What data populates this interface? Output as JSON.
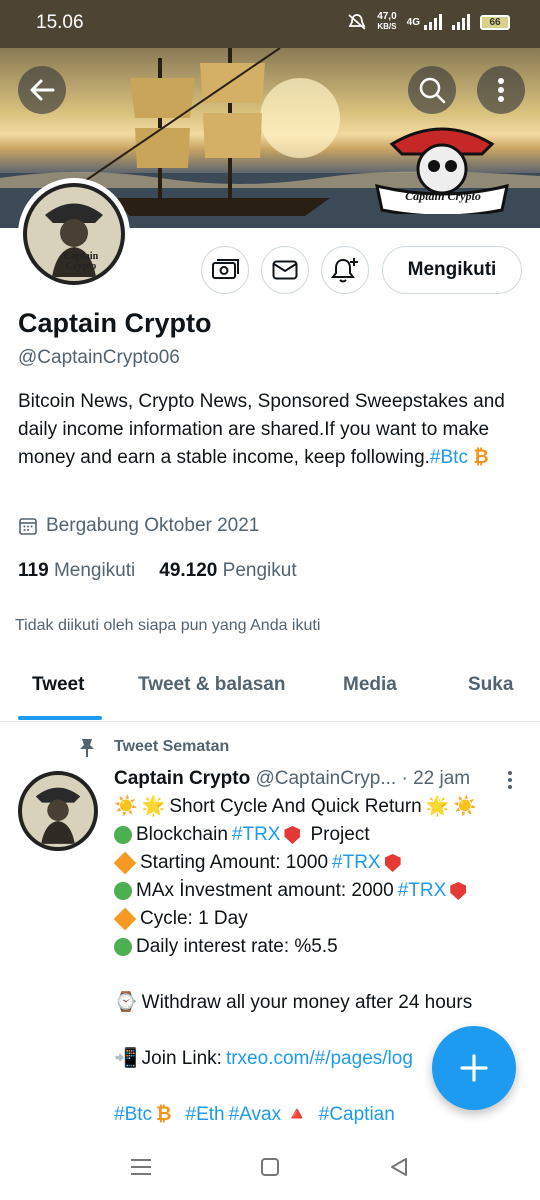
{
  "status_bar": {
    "time": "15.06",
    "net_speed_value": "47,0",
    "net_speed_unit": "KB/S",
    "network": "4G",
    "battery": "66"
  },
  "header": {
    "banner_logo_text": "Captain Crypto"
  },
  "profile": {
    "avatar_text": "Captain Crypto",
    "follow_button_label": "Mengikuti",
    "name": "Captain Crypto",
    "handle": "@CaptainCrypto06",
    "bio_text": "Bitcoin News, Crypto News, Sponsored Sweepstakes and daily income information are shared.If you want to make money and earn a stable income, keep following.",
    "bio_hashtag": "#Btc",
    "bio_emoji": "₿",
    "joined": "Bergabung Oktober 2021",
    "following_count": "119",
    "following_label": "Mengikuti",
    "followers_count": "49.120",
    "followers_label": "Pengikut",
    "not_followed_note": "Tidak diikuti oleh siapa pun yang Anda ikuti"
  },
  "tabs": [
    {
      "label": "Tweet",
      "active": true
    },
    {
      "label": "Tweet & balasan",
      "active": false
    },
    {
      "label": "Media",
      "active": false
    },
    {
      "label": "Suka",
      "active": false
    }
  ],
  "pinned_tweet": {
    "pinned_label": "Tweet Sematan",
    "author_name": "Captain Crypto",
    "author_handle": "@CaptainCryp...",
    "separator": "·",
    "time": "22 jam",
    "line1": "Short Cycle And Quick Return",
    "line2_text": "Blockchain",
    "line2_tag": "#TRX",
    "line2_end": "Project",
    "line3_text": "Starting Amount: 1000",
    "line3_tag": "#TRX",
    "line4_text": "MAx İnvestment amount: 2000",
    "line4_tag": "#TRX",
    "line5_text": "Cycle: 1 Day",
    "line6_text": "Daily interest rate: %5.5",
    "line7_text": "Withdraw all your money after 24 hours",
    "line8_text": "Join Link:",
    "line8_link": "trxeo.com/#/pages/log",
    "tags": [
      "#Btc",
      "#Eth",
      "#Avax",
      "#Captian"
    ],
    "emoji_sun": "☀️",
    "emoji_star": "🌟",
    "emoji_watch": "⌚",
    "emoji_phone": "📲",
    "emoji_btc": "₿",
    "emoji_triangle": "🔺"
  },
  "colors": {
    "accent": "#1d9bf0",
    "text_primary": "#0f1419",
    "text_secondary": "#536471",
    "status_bar": "#4d4433"
  }
}
